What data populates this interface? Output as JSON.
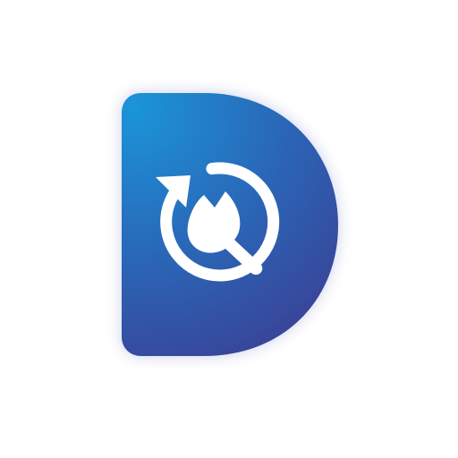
{
  "logo": {
    "letter_shape": "D",
    "icon": "wrench-refresh-icon",
    "colors": {
      "gradient_start": "#1b95d8",
      "gradient_mid": "#2a67b8",
      "gradient_end": "#3b3f94",
      "glyph": "#ffffff",
      "background": "#ffffff"
    }
  }
}
